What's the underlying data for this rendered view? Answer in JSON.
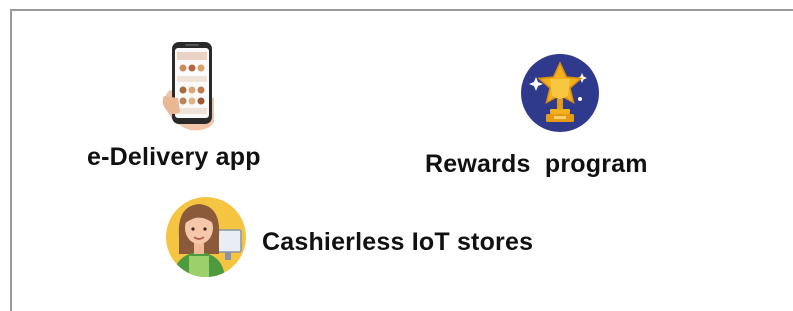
{
  "features": [
    {
      "label": "e-Delivery app",
      "icon": "smartphone-icon"
    },
    {
      "label": "Rewards  program",
      "icon": "trophy-icon"
    },
    {
      "label": "Cashierless IoT stores",
      "icon": "cashier-icon"
    }
  ],
  "colors": {
    "frame": "#9a9a9a",
    "text": "#111111",
    "trophy_bg": "#2f3a8c",
    "gold": "#f2b01e",
    "cashier_bg": "#f5c542"
  }
}
